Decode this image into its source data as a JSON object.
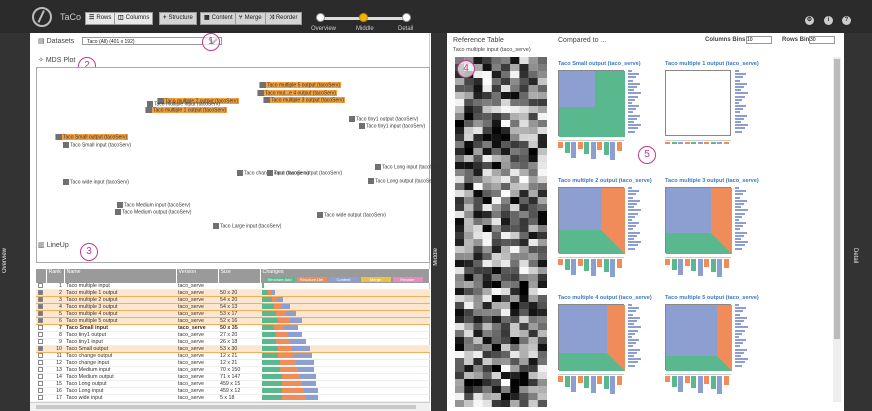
{
  "topbar": {
    "app_name": "TaCo",
    "buttons": [
      {
        "icon": "rows-icon",
        "label": "Rows"
      },
      {
        "icon": "columns-icon",
        "label": "Columns"
      },
      {
        "icon": "structure-icon",
        "label": "Structure"
      },
      {
        "icon": "content-icon",
        "label": "Content"
      },
      {
        "icon": "merge-icon",
        "label": "Merge"
      },
      {
        "icon": "reorder-icon",
        "label": "Reorder"
      }
    ],
    "detail_slider": {
      "labels": [
        "Overview",
        "Middle",
        "Detail"
      ],
      "selected": "Middle"
    },
    "icons": [
      "gear-icon",
      "info-icon",
      "help-icon"
    ]
  },
  "sidebars": {
    "left": "Overview",
    "middle": "Middle",
    "right": "Detail"
  },
  "left": {
    "datasets_label": "Datasets",
    "dataset_value": "Taco (All) (401 x 192)",
    "mds_title": "MDS Plot",
    "lineup_title": "LineUp"
  },
  "annotations": [
    "1",
    "2",
    "3",
    "4",
    "5"
  ],
  "mds_nodes": [
    {
      "label": "Taco multiple 5 output (tacoServ)",
      "hl": true
    },
    {
      "label": "Taco mul...e 4 output (tacoServ)",
      "hl": true
    },
    {
      "label": "Taco multiple 3 output (tacoServ)",
      "hl": true
    },
    {
      "label": "Taco multiple 2 output (tacoServ)",
      "hl": true
    },
    {
      "label": "Taco multiple 1 output (tacoServ)",
      "hl": true
    },
    {
      "label": "Taco multiple input (tacoServ)",
      "hl": false
    },
    {
      "label": "Taco Small output (tacoServ)",
      "hl": true
    },
    {
      "label": "Taco Small input (tacoServ)",
      "hl": false
    },
    {
      "label": "Taco tiny1 output (tacoServ)",
      "hl": false
    },
    {
      "label": "Taco tiny1 input (tacoServ)",
      "hl": false
    },
    {
      "label": "Taco wide input (tacoServ)",
      "hl": false
    },
    {
      "label": "Taco change input (tacoServ)",
      "hl": false
    },
    {
      "label": "Taco change output (tacoServ)",
      "hl": false
    },
    {
      "label": "Taco Long input (tacoServ)",
      "hl": false
    },
    {
      "label": "Taco Long output (tacoServ)",
      "hl": false
    },
    {
      "label": "Taco Medium input (tacoServ)",
      "hl": false
    },
    {
      "label": "Taco Medium output (tacoServ)",
      "hl": false
    },
    {
      "label": "Taco wide output (tacoServ)",
      "hl": false
    },
    {
      "label": "Taco Large input (tacoServ)",
      "hl": false
    }
  ],
  "lineup": {
    "headers": [
      "Rank",
      "Name",
      "Version",
      "Size",
      "Changes"
    ],
    "change_chips": [
      {
        "label": "Structure Add",
        "color": "#5ab88f"
      },
      {
        "label": "Structure Del",
        "color": "#f08c5a"
      },
      {
        "label": "Content",
        "color": "#8c9fd0"
      },
      {
        "label": "Merge",
        "color": "#f0c040"
      },
      {
        "label": "Reorder",
        "color": "#e88ac0"
      }
    ],
    "rows": [
      {
        "rank": "1",
        "name": "Taco multiple input",
        "version": "taco_serve",
        "size": "",
        "sel": false,
        "checked": false,
        "bold": false,
        "bars": [
          2,
          0,
          0
        ]
      },
      {
        "rank": "2",
        "name": "Taco multiple 1 output",
        "version": "taco_serve",
        "size": "50 x 20",
        "sel": true,
        "checked": true,
        "bold": false,
        "bars": [
          6,
          3,
          4
        ]
      },
      {
        "rank": "3",
        "name": "Taco multiple 2 output",
        "version": "taco_serve",
        "size": "54 x 20",
        "sel": true,
        "checked": true,
        "bold": false,
        "bars": [
          10,
          5,
          6
        ]
      },
      {
        "rank": "4",
        "name": "Taco multiple 3 output",
        "version": "taco_serve",
        "size": "54 x 13",
        "sel": true,
        "checked": true,
        "bold": false,
        "bars": [
          12,
          8,
          8
        ]
      },
      {
        "rank": "5",
        "name": "Taco multiple 4 output",
        "version": "taco_serve",
        "size": "53 x 17",
        "sel": true,
        "checked": true,
        "bold": false,
        "bars": [
          14,
          10,
          10
        ]
      },
      {
        "rank": "6",
        "name": "Taco multiple 5 output",
        "version": "taco_serve",
        "size": "52 x 16",
        "sel": true,
        "checked": true,
        "bold": false,
        "bars": [
          16,
          12,
          12
        ]
      },
      {
        "rank": "7",
        "name": "Taco Small input",
        "version": "taco_serve",
        "size": "50 x 35",
        "sel": false,
        "checked": false,
        "bold": true,
        "bars": [
          12,
          10,
          14
        ]
      },
      {
        "rank": "8",
        "name": "Taco tiny1 output",
        "version": "taco_serve",
        "size": "27 x 20",
        "sel": false,
        "checked": false,
        "bold": false,
        "bars": [
          14,
          12,
          14
        ]
      },
      {
        "rank": "9",
        "name": "Taco tiny1 input",
        "version": "taco_serve",
        "size": "26 x 18",
        "sel": false,
        "checked": false,
        "bold": false,
        "bars": [
          14,
          14,
          16
        ]
      },
      {
        "rank": "10",
        "name": "Taco Small output",
        "version": "taco_serve",
        "size": "53 x 30",
        "sel": true,
        "checked": true,
        "bold": false,
        "bars": [
          16,
          14,
          18
        ]
      },
      {
        "rank": "11",
        "name": "Taco change output",
        "version": "taco_serve",
        "size": "12 x 21",
        "sel": false,
        "checked": false,
        "bold": false,
        "bars": [
          16,
          16,
          18
        ]
      },
      {
        "rank": "12",
        "name": "Taco change input",
        "version": "taco_serve",
        "size": "12 x 21",
        "sel": false,
        "checked": false,
        "bold": false,
        "bars": [
          18,
          16,
          18
        ]
      },
      {
        "rank": "13",
        "name": "Taco Medium input",
        "version": "taco_serve",
        "size": "70 x 150",
        "sel": false,
        "checked": false,
        "bold": false,
        "bars": [
          18,
          18,
          16
        ]
      },
      {
        "rank": "14",
        "name": "Taco Medium output",
        "version": "taco_serve",
        "size": "71 x 147",
        "sel": false,
        "checked": false,
        "bold": false,
        "bars": [
          20,
          18,
          16
        ]
      },
      {
        "rank": "15",
        "name": "Taco Long output",
        "version": "taco_serve",
        "size": "459 x 15",
        "sel": false,
        "checked": false,
        "bold": false,
        "bars": [
          20,
          20,
          14
        ]
      },
      {
        "rank": "16",
        "name": "Taco Long input",
        "version": "taco_serve",
        "size": "459 x 12",
        "sel": false,
        "checked": false,
        "bold": false,
        "bars": [
          20,
          22,
          14
        ]
      },
      {
        "rank": "17",
        "name": "Taco wide input",
        "version": "taco_serve",
        "size": "5 x 18",
        "sel": false,
        "checked": false,
        "bold": false,
        "bars": [
          20,
          24,
          12
        ]
      },
      {
        "rank": "18",
        "name": "Taco wide output",
        "version": "taco_serve",
        "size": "4 x 118",
        "sel": false,
        "checked": false,
        "bold": false,
        "bars": [
          22,
          24,
          10
        ]
      }
    ]
  },
  "right": {
    "ref_title": "Reference Table",
    "compared_title": "Compared to ...",
    "ref_name": "Taco multiple input (taco_serve)",
    "col_bins_label": "Columns Bins",
    "col_bins_value": "10",
    "row_bins_label": "Rows Bins",
    "row_bins_value": "30",
    "comparisons": [
      "Taco Small output (taco_serve)",
      "Taco multiple 1 output (taco_serve)",
      "Taco multiple 2 output (taco_serve)",
      "Taco multiple 3 output (taco_serve)",
      "Taco multiple 4 output (taco_serve)",
      "Taco multiple 5 output (taco_serve)"
    ]
  },
  "colors": {
    "structure_add": "#5ab88f",
    "structure_del": "#f08c5a",
    "content": "#8c9fd0",
    "highlight": "#f0a040",
    "annotation": "#c03a8c"
  }
}
